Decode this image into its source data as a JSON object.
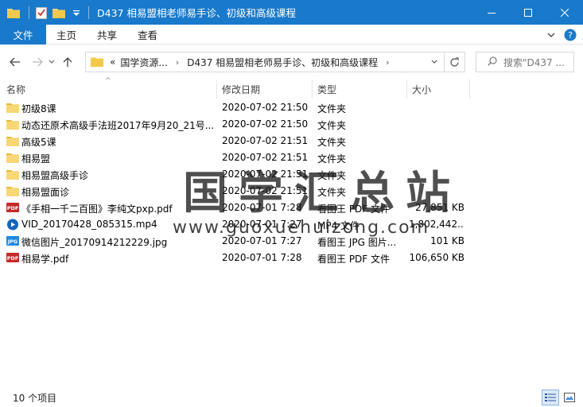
{
  "window": {
    "title": "D437 相易盟相老师易手诊、初级和高级课程"
  },
  "ribbon": {
    "file_tab": "文件",
    "tabs": [
      "主页",
      "共享",
      "查看"
    ]
  },
  "address": {
    "overflow": "«",
    "crumbs": [
      "国学资源...",
      "D437 相易盟相老师易手诊、初级和高级课程"
    ]
  },
  "search": {
    "placeholder": "搜索\"D437 ..."
  },
  "columns": {
    "name": "名称",
    "date": "修改日期",
    "type": "类型",
    "size": "大小"
  },
  "files": [
    {
      "name": "初级8课",
      "date": "2020-07-02 21:50",
      "type": "文件夹",
      "size": "",
      "icon": "folder-icon"
    },
    {
      "name": "动态还原术高级手法班2017年9月20_21号...",
      "date": "2020-07-02 21:50",
      "type": "文件夹",
      "size": "",
      "icon": "folder-icon"
    },
    {
      "name": "高级5课",
      "date": "2020-07-02 21:51",
      "type": "文件夹",
      "size": "",
      "icon": "folder-icon"
    },
    {
      "name": "相易盟",
      "date": "2020-07-02 21:51",
      "type": "文件夹",
      "size": "",
      "icon": "folder-icon"
    },
    {
      "name": "相易盟高级手诊",
      "date": "2020-07-02 21:51",
      "type": "文件夹",
      "size": "",
      "icon": "folder-icon"
    },
    {
      "name": "相易盟面诊",
      "date": "2020-07-02 21:51",
      "type": "文件夹",
      "size": "",
      "icon": "folder-icon"
    },
    {
      "name": "《手相一千二百图》李纯文pxp.pdf",
      "date": "2020-07-01 7:28",
      "type": "看图王 PDF 文件",
      "size": "27,851 KB",
      "icon": "pdf-icon"
    },
    {
      "name": "VID_20170428_085315.mp4",
      "date": "2020-07-01 7:27",
      "type": "MP4 文件",
      "size": "1,802,442...",
      "icon": "mp4-icon"
    },
    {
      "name": "微信图片_20170914212229.jpg",
      "date": "2020-07-01 7:27",
      "type": "看图王 JPG 图片...",
      "size": "101 KB",
      "icon": "jpg-icon"
    },
    {
      "name": "相易学.pdf",
      "date": "2020-07-01 7:28",
      "type": "看图王 PDF 文件",
      "size": "106,650 KB",
      "icon": "pdf-icon"
    }
  ],
  "watermark": {
    "line1": "国学汇总站",
    "line2": "www.guoxuehuizong.com"
  },
  "status": {
    "count": "10 个项目"
  },
  "colors": {
    "titlebar": "#1979ca",
    "folder": "#f8d775",
    "pdf": "#c62828",
    "mp4": "#1565c0",
    "jpg": "#1e88e5"
  }
}
